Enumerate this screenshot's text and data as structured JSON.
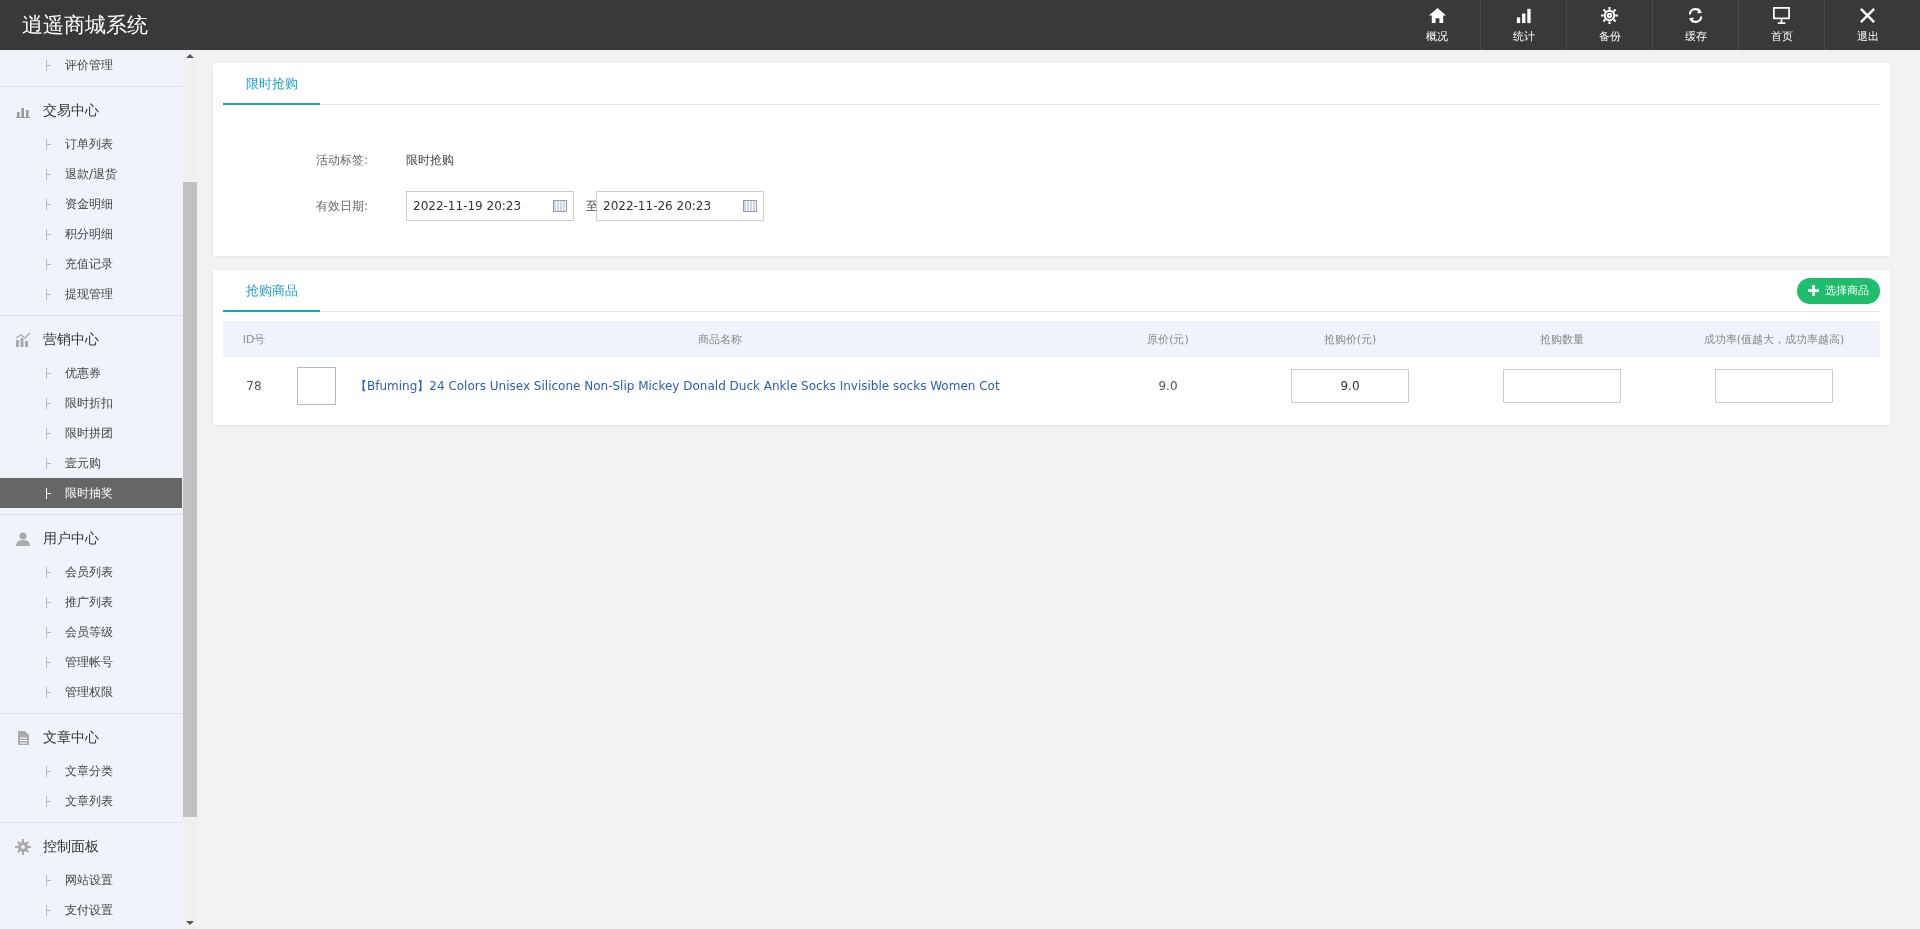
{
  "app_title": "逍遥商城系统",
  "top_nav": [
    {
      "kind": "home",
      "label": "概况"
    },
    {
      "kind": "stats",
      "label": "统计"
    },
    {
      "kind": "gear",
      "label": "备份"
    },
    {
      "kind": "refresh",
      "label": "缓存"
    },
    {
      "kind": "monitor",
      "label": "首页"
    },
    {
      "kind": "close",
      "label": "退出"
    }
  ],
  "sidebar": [
    {
      "items": [
        {
          "label": "评价管理",
          "selected": false
        }
      ]
    },
    {
      "title": "交易中心",
      "kind": "bars",
      "items": [
        {
          "label": "订单列表",
          "selected": false
        },
        {
          "label": "退款/退货",
          "selected": false
        },
        {
          "label": "资金明细",
          "selected": false
        },
        {
          "label": "积分明细",
          "selected": false
        },
        {
          "label": "充值记录",
          "selected": false
        },
        {
          "label": "提现管理",
          "selected": false
        }
      ]
    },
    {
      "title": "营销中心",
      "kind": "chart",
      "items": [
        {
          "label": "优惠券",
          "selected": false
        },
        {
          "label": "限时折扣",
          "selected": false
        },
        {
          "label": "限时拼团",
          "selected": false
        },
        {
          "label": "壹元购",
          "selected": false
        },
        {
          "label": "限时抽奖",
          "selected": true
        }
      ]
    },
    {
      "title": "用户中心",
      "kind": "user",
      "items": [
        {
          "label": "会员列表",
          "selected": false
        },
        {
          "label": "推广列表",
          "selected": false
        },
        {
          "label": "会员等级",
          "selected": false
        },
        {
          "label": "管理帐号",
          "selected": false
        },
        {
          "label": "管理权限",
          "selected": false
        }
      ]
    },
    {
      "title": "文章中心",
      "kind": "doc",
      "items": [
        {
          "label": "文章分类",
          "selected": false
        },
        {
          "label": "文章列表",
          "selected": false
        }
      ]
    },
    {
      "title": "控制面板",
      "kind": "gear",
      "items": [
        {
          "label": "网站设置",
          "selected": false
        },
        {
          "label": "支付设置",
          "selected": false
        }
      ]
    }
  ],
  "activity_card": {
    "tab": "限时抢购",
    "tag_label": "活动标签:",
    "tag_value": "限时抢购",
    "date_label": "有效日期:",
    "start_date": "2022-11-19 20:23",
    "separator": "至",
    "end_date": "2022-11-26 20:23"
  },
  "goods_card": {
    "tab": "抢购商品",
    "add_button": "选择商品",
    "table": {
      "columns": [
        "ID号",
        "",
        "商品名称",
        "原价(元)",
        "抢购价(元)",
        "抢购数量",
        "成功率(值越大，成功率越高)"
      ],
      "rows": [
        {
          "id": "78",
          "name": "【Bfuming】24 Colors Unisex Silicone Non-Slip Mickey Donald Duck Ankle Socks Invisible socks Women Cot",
          "price": "9.0",
          "flash_price": "9.0"
        }
      ]
    }
  }
}
